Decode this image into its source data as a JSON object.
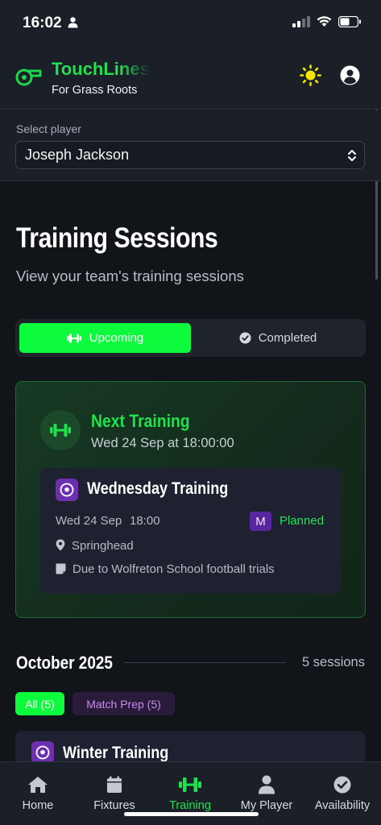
{
  "status_bar": {
    "time": "16:02"
  },
  "header": {
    "brand_name": "TouchLines",
    "tagline": "For Grass Roots",
    "icons": [
      "whistle-icon",
      "sun-icon",
      "account-icon"
    ],
    "brand_color": "#17d64a"
  },
  "player_select": {
    "label": "Select player",
    "value": "Joseph Jackson"
  },
  "page": {
    "title": "Training Sessions",
    "subtitle": "View your team's training sessions"
  },
  "toggle": {
    "upcoming_label": "Upcoming",
    "completed_label": "Completed",
    "selected": "Upcoming",
    "accent": "#0dfb3d"
  },
  "next_training": {
    "heading": "Next Training",
    "datetime": "Wed 24 Sep at 18:00:00",
    "session": {
      "title": "Wednesday Training",
      "date": "Wed 24 Sep",
      "time": "18:00",
      "badge": "M",
      "status": "Planned",
      "location": "Springhead",
      "note": "Due to Wolfreton School football trials"
    }
  },
  "month_group": {
    "month": "October 2025",
    "count": "5 sessions",
    "filters": [
      {
        "label": "All (5)",
        "selected": true
      },
      {
        "label": "Match Prep (5)",
        "selected": false
      }
    ],
    "sessions": [
      {
        "title": "Winter Training"
      }
    ]
  },
  "bottom_nav": {
    "items": [
      {
        "label": "Home",
        "icon": "home-icon"
      },
      {
        "label": "Fixtures",
        "icon": "calendar-icon"
      },
      {
        "label": "Training",
        "icon": "dumbbell-icon",
        "active": true
      },
      {
        "label": "My Player",
        "icon": "person-icon"
      },
      {
        "label": "Availability",
        "icon": "check-circle-icon"
      }
    ]
  }
}
